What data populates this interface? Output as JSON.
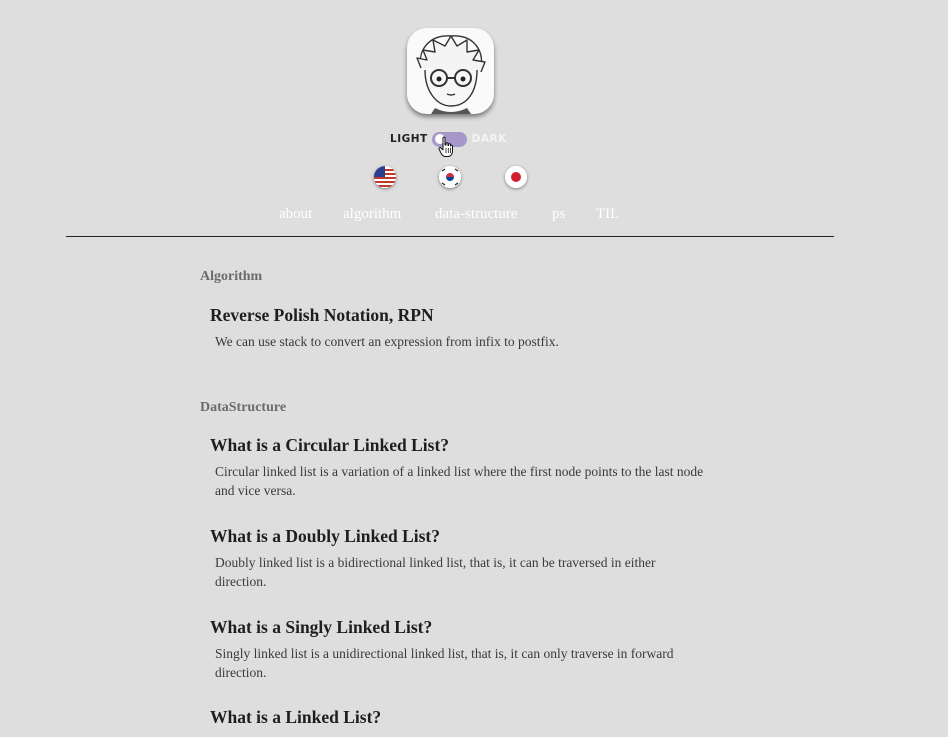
{
  "theme": {
    "light_label": "LIGHT",
    "dark_label": "DARK"
  },
  "languages": [
    {
      "code": "en"
    },
    {
      "code": "ko"
    },
    {
      "code": "ja"
    }
  ],
  "nav": {
    "items": [
      "about",
      "algorithm",
      "data-structure",
      "ps",
      "TIL"
    ]
  },
  "sections": [
    {
      "title": "Algorithm",
      "posts": [
        {
          "title": "Reverse Polish Notation, RPN",
          "description": "We can use stack to convert an expression from infix to postfix."
        }
      ]
    },
    {
      "title": "DataStructure",
      "posts": [
        {
          "title": "What is a Circular Linked List?",
          "description": "Circular linked list is a variation of a linked list where the first node points to the last node and vice versa."
        },
        {
          "title": "What is a Doubly Linked List?",
          "description": "Doubly linked list is a bidirectional linked list, that is, it can be traversed in either direction."
        },
        {
          "title": "What is a Singly Linked List?",
          "description": "Singly linked list is a unidirectional linked list, that is, it can only traverse in forward direction."
        },
        {
          "title": "What is a Linked List?",
          "description": ""
        }
      ]
    }
  ],
  "colors": {
    "background": "#dedede",
    "toggle_track": "#a597c9",
    "nav_text": "#ffffff",
    "section_title": "#6b6b6b"
  },
  "icons": {
    "avatar": "cartoon-avatar",
    "cursor": "hand-pointer-icon"
  }
}
